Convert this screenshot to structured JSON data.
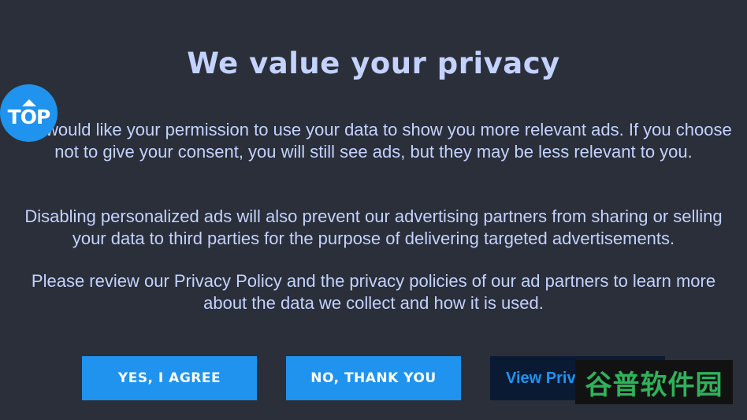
{
  "dialog": {
    "title": "We value your privacy",
    "paragraphs": [
      "We would like your permission to use your data to show you more relevant ads. If you choose not to give your consent, you will still see ads, but they may be less relevant to you.",
      "Disabling personalized ads will also prevent our advertising partners from sharing or selling your data to third parties for the purpose of delivering targeted advertisements.",
      "Please review our Privacy Policy and the privacy policies of our ad partners to learn more about the data we collect and how it is used."
    ],
    "buttons": {
      "agree": "YES, I AGREE",
      "decline": "NO, THANK YOU",
      "policy": "View Privacy Policy"
    }
  },
  "overlay": {
    "top_badge": "TOP",
    "watermark": "谷普软件园"
  },
  "colors": {
    "background": "#2a2f39",
    "text": "#c4d2ff",
    "accent": "#1f93ee",
    "policy_button_bg": "#0a1a33",
    "watermark_green": "#2fb25a"
  }
}
